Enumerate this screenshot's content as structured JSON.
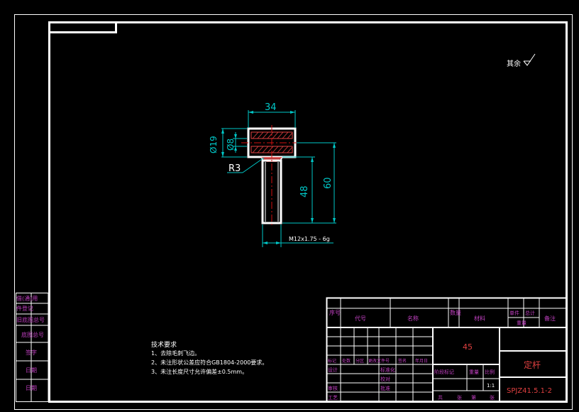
{
  "colors": {
    "background": "#000000",
    "frame": "#ffffff",
    "dimension": "#00c8c8",
    "centerline": "#d01010",
    "margin_labels": "#c040c0",
    "hatch": "#e04040"
  },
  "surface_finish_note": "其余",
  "dimensions": {
    "width_34": "34",
    "dia_19": "Ø19",
    "dia_8": "Ø8",
    "radius_3": "R3",
    "length_48": "48",
    "length_60": "60",
    "thread": "M12x1.75 - 6g"
  },
  "tech_requirements": {
    "title": "技术要求",
    "items": [
      "1、去除毛刺飞边。",
      "2、未注形状公差应符合GB1804-2000要求。",
      "3、未注长度尺寸允许偏差±0.5mm。"
    ]
  },
  "margin_labels": [
    "借(通)用",
    "件登记",
    "旧底图总号",
    "底图总号",
    "签字",
    "日期",
    "日期"
  ],
  "title_block": {
    "header": [
      "序号",
      "代号",
      "名称",
      "材料",
      "数量",
      "单件",
      "总计",
      "备注",
      "重量"
    ],
    "material": "45",
    "part_name": "定杆",
    "drawing_number": "SPJZ41.5.1-2",
    "scale": "1:1",
    "row_labels": [
      "设计",
      "校对",
      "审核",
      "批准",
      "标记",
      "处数",
      "分区",
      "更改文件号",
      "签名",
      "年月日",
      "标准化",
      "工艺"
    ],
    "stage_labels": [
      "阶段标记",
      "重量",
      "比例"
    ],
    "sheet_labels": [
      "共",
      "张",
      "第",
      "张"
    ]
  }
}
